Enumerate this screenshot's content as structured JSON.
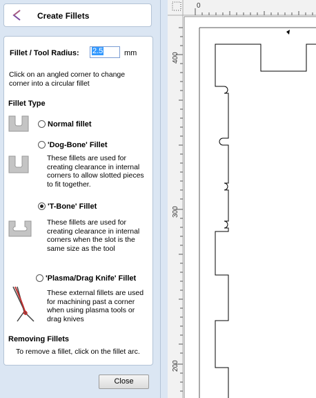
{
  "header": {
    "title": "Create Fillets"
  },
  "radius": {
    "label": "Fillet / Tool Radius:",
    "value": "2.5",
    "unit": "mm"
  },
  "instruction": "Click on an angled corner to change corner into a circular fillet",
  "fillet_type": {
    "heading": "Fillet Type",
    "options": [
      {
        "label": "Normal fillet",
        "selected": false,
        "description": "",
        "icon": "normal-fillet-icon"
      },
      {
        "label": "'Dog-Bone' Fillet",
        "selected": false,
        "description": "These fillets are used for creating clearance in internal corners to allow slotted pieces to fit together.",
        "icon": "dog-bone-fillet-icon"
      },
      {
        "label": "'T-Bone' Fillet",
        "selected": true,
        "description": "These fillets are used for creating clearance in internal corners when the slot is the same size as the tool",
        "icon": "t-bone-fillet-icon"
      },
      {
        "label": "'Plasma/Drag Knife' Fillet",
        "selected": false,
        "description": "These external fillets are used for machining past a corner when using plasma tools or drag knives",
        "icon": "plasma-drag-knife-icon"
      }
    ]
  },
  "removing": {
    "heading": "Removing Fillets",
    "text": "To remove a fillet, click on the fillet arc."
  },
  "buttons": {
    "close": "Close"
  },
  "ruler": {
    "top_tick": "0",
    "left_ticks": [
      "400",
      "300",
      "200"
    ]
  },
  "colors": {
    "panel_bg": "#dbe6f3",
    "border": "#b3c3d6",
    "selection": "#3399ff",
    "accent": "#7a4aa0"
  }
}
